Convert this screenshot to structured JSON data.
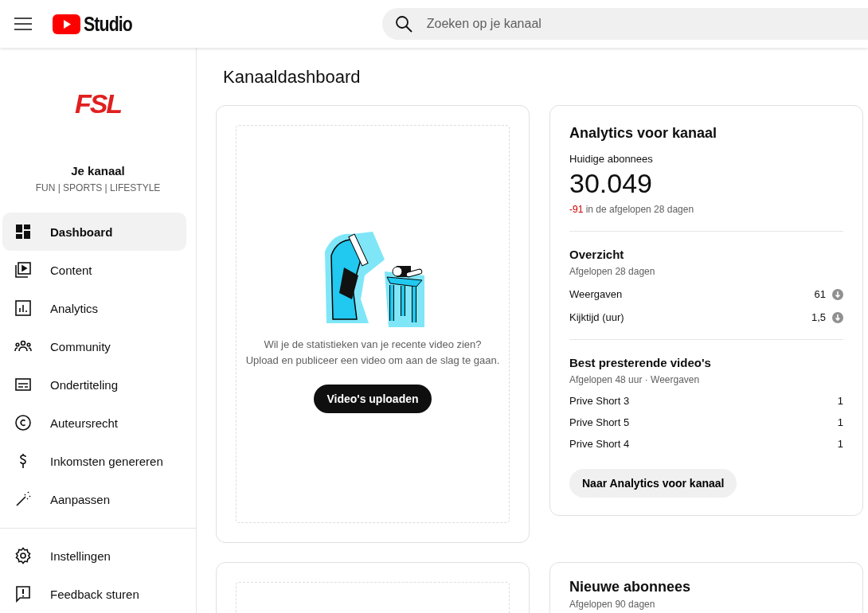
{
  "header": {
    "logo_text": "Studio",
    "search": {
      "placeholder": "Zoeken op je kanaal"
    }
  },
  "sidebar": {
    "channel": {
      "logo_text": "FSL",
      "name": "Je kanaal",
      "tagline": "FUN | SPORTS | LIFESTYLE"
    },
    "items": [
      {
        "label": "Dashboard",
        "kind": "dashboard",
        "selected": true
      },
      {
        "label": "Content",
        "kind": "content",
        "selected": false
      },
      {
        "label": "Analytics",
        "kind": "analytics",
        "selected": false
      },
      {
        "label": "Community",
        "kind": "community",
        "selected": false
      },
      {
        "label": "Ondertiteling",
        "kind": "subtitles",
        "selected": false
      },
      {
        "label": "Auteursrecht",
        "kind": "copyright",
        "selected": false
      },
      {
        "label": "Inkomsten genereren",
        "kind": "money",
        "selected": false
      },
      {
        "label": "Aanpassen",
        "kind": "customize",
        "selected": false
      }
    ],
    "bottom_items": [
      {
        "label": "Instellingen",
        "kind": "settings",
        "selected": false
      },
      {
        "label": "Feedback sturen",
        "kind": "feedback",
        "selected": false
      }
    ]
  },
  "page_title": "Kanaaldashboard",
  "upload_card": {
    "text_lines": [
      "Wil je de statistieken van je recente video zien?",
      "Upload en publiceer een video om aan de slag te gaan."
    ],
    "button": "Video's uploaden"
  },
  "analytics_card": {
    "title": "Analytics voor kanaal",
    "subscribers_label": "Huidige abonnees",
    "subscribers": "30.049",
    "change": "-91",
    "change_note": "in de afgelopen 28 dagen",
    "overview": {
      "title": "Overzicht",
      "period": "Afgelopen 28 dagen",
      "metrics": [
        {
          "label": "Weergaven",
          "value": "61",
          "decreased": true
        },
        {
          "label": "Kijktijd (uur)",
          "value": "1,5",
          "decreased": true
        }
      ]
    },
    "top_videos": {
      "title": "Best presterende video's",
      "period": "Afgelopen 48 uur · Weergaven",
      "rows": [
        {
          "title": "Prive Short 3",
          "value": "1"
        },
        {
          "title": "Prive Short 5",
          "value": "1"
        },
        {
          "title": "Prive Short 4",
          "value": "1"
        }
      ]
    },
    "button": "Naar Analytics voor kanaal"
  },
  "subscribers_card": {
    "title": "Nieuwe abonnees",
    "period": "Afgelopen 90 dagen"
  }
}
